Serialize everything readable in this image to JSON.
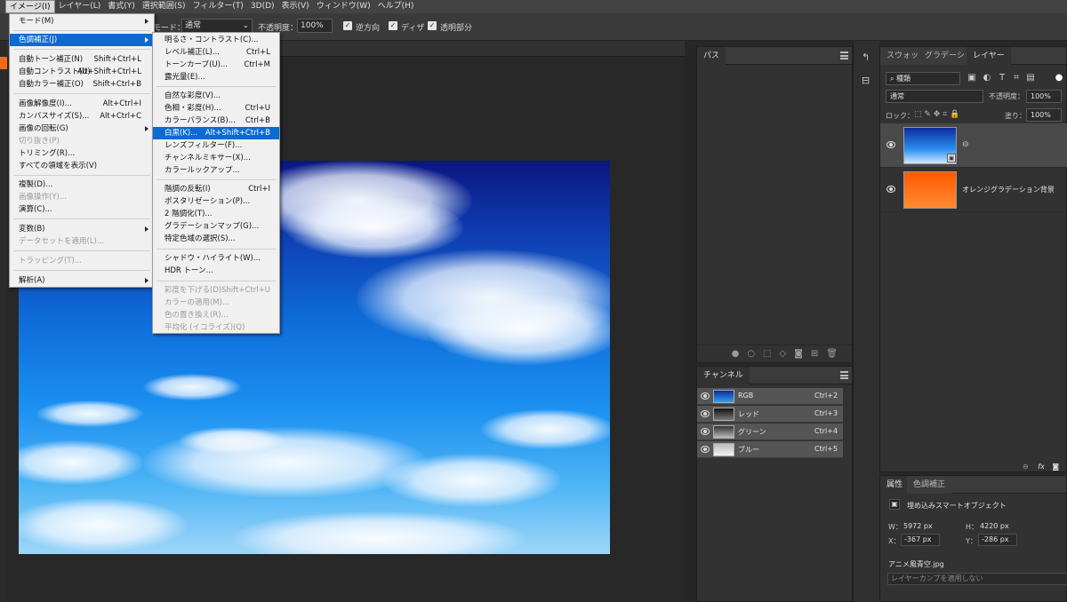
{
  "menubar": {
    "items": [
      "イメージ(I)",
      "レイヤー(L)",
      "書式(Y)",
      "選択範囲(S)",
      "フィルター(T)",
      "3D(D)",
      "表示(V)",
      "ウィンドウ(W)",
      "ヘルプ(H)"
    ]
  },
  "options": {
    "mode_label": "モード：",
    "mode_value": "通常",
    "opacity_label": "不透明度：",
    "opacity_value": "100%",
    "reverse": "逆方向",
    "dither": "ディザ",
    "transparency": "透明部分"
  },
  "image_menu": {
    "items": [
      {
        "label": "モード(M)",
        "shortcut": "",
        "submenu": true,
        "disabled": false
      },
      {
        "label": "色調補正(J)",
        "shortcut": "",
        "submenu": true,
        "disabled": false
      },
      {
        "label": "自動トーン補正(N)",
        "shortcut": "Shift+Ctrl+L",
        "submenu": false,
        "disabled": false
      },
      {
        "label": "自動コントラスト(U)",
        "shortcut": "Alt+Shift+Ctrl+L",
        "submenu": false,
        "disabled": false
      },
      {
        "label": "自動カラー補正(O)",
        "shortcut": "Shift+Ctrl+B",
        "submenu": false,
        "disabled": false
      },
      {
        "label": "画像解像度(I)...",
        "shortcut": "Alt+Ctrl+I",
        "submenu": false,
        "disabled": false
      },
      {
        "label": "カンバスサイズ(S)...",
        "shortcut": "Alt+Ctrl+C",
        "submenu": false,
        "disabled": false
      },
      {
        "label": "画像の回転(G)",
        "shortcut": "",
        "submenu": true,
        "disabled": false
      },
      {
        "label": "切り抜き(P)",
        "shortcut": "",
        "submenu": false,
        "disabled": true
      },
      {
        "label": "トリミング(R)...",
        "shortcut": "",
        "submenu": false,
        "disabled": false
      },
      {
        "label": "すべての領域を表示(V)",
        "shortcut": "",
        "submenu": false,
        "disabled": false
      },
      {
        "label": "複製(D)...",
        "shortcut": "",
        "submenu": false,
        "disabled": false
      },
      {
        "label": "画像操作(Y)...",
        "shortcut": "",
        "submenu": false,
        "disabled": true
      },
      {
        "label": "演算(C)...",
        "shortcut": "",
        "submenu": false,
        "disabled": false
      },
      {
        "label": "変数(B)",
        "shortcut": "",
        "submenu": true,
        "disabled": false
      },
      {
        "label": "データセットを適用(L)...",
        "shortcut": "",
        "submenu": false,
        "disabled": true
      },
      {
        "label": "トラッピング(T)...",
        "shortcut": "",
        "submenu": false,
        "disabled": true
      },
      {
        "label": "解析(A)",
        "shortcut": "",
        "submenu": true,
        "disabled": false
      }
    ]
  },
  "adjust_menu": {
    "items": [
      {
        "label": "明るさ・コントラスト(C)...",
        "shortcut": "",
        "disabled": false
      },
      {
        "label": "レベル補正(L)...",
        "shortcut": "Ctrl+L",
        "disabled": false
      },
      {
        "label": "トーンカーブ(U)...",
        "shortcut": "Ctrl+M",
        "disabled": false
      },
      {
        "label": "露光量(E)...",
        "shortcut": "",
        "disabled": false
      },
      {
        "label": "自然な彩度(V)...",
        "shortcut": "",
        "disabled": false
      },
      {
        "label": "色相・彩度(H)...",
        "shortcut": "Ctrl+U",
        "disabled": false
      },
      {
        "label": "カラーバランス(B)...",
        "shortcut": "Ctrl+B",
        "disabled": false
      },
      {
        "label": "白黒(K)...",
        "shortcut": "Alt+Shift+Ctrl+B",
        "disabled": false
      },
      {
        "label": "レンズフィルター(F)...",
        "shortcut": "",
        "disabled": false
      },
      {
        "label": "チャンネルミキサー(X)...",
        "shortcut": "",
        "disabled": false
      },
      {
        "label": "カラールックアップ...",
        "shortcut": "",
        "disabled": false
      },
      {
        "label": "階調の反転(I)",
        "shortcut": "Ctrl+I",
        "disabled": false
      },
      {
        "label": "ポスタリゼーション(P)...",
        "shortcut": "",
        "disabled": false
      },
      {
        "label": "2 階調化(T)...",
        "shortcut": "",
        "disabled": false
      },
      {
        "label": "グラデーションマップ(G)...",
        "shortcut": "",
        "disabled": false
      },
      {
        "label": "特定色域の選択(S)...",
        "shortcut": "",
        "disabled": false
      },
      {
        "label": "シャドウ・ハイライト(W)...",
        "shortcut": "",
        "disabled": false
      },
      {
        "label": "HDR トーン...",
        "shortcut": "",
        "disabled": false
      },
      {
        "label": "彩度を下げる(D)",
        "shortcut": "Shift+Ctrl+U",
        "disabled": true
      },
      {
        "label": "カラーの適用(M)...",
        "shortcut": "",
        "disabled": true
      },
      {
        "label": "色の置き換え(R)...",
        "shortcut": "",
        "disabled": true
      },
      {
        "label": "平均化 (イコライズ)(Q)",
        "shortcut": "",
        "disabled": true
      }
    ]
  },
  "paths_panel": {
    "title": "パス"
  },
  "channels_panel": {
    "title": "チャンネル",
    "rows": [
      {
        "name": "RGB",
        "shortcut": "Ctrl+2"
      },
      {
        "name": "レッド",
        "shortcut": "Ctrl+3"
      },
      {
        "name": "グリーン",
        "shortcut": "Ctrl+4"
      },
      {
        "name": "ブルー",
        "shortcut": "Ctrl+5"
      }
    ]
  },
  "layers_panel": {
    "tabs": [
      "スウォッチ",
      "グラデーション",
      "レイヤー"
    ],
    "kind_filter": "種類",
    "blend_mode": "通常",
    "opacity_label": "不透明度：",
    "opacity_value": "100%",
    "lock_label": "ロック：",
    "fill_label": "塗り：",
    "fill_value": "100%",
    "layers": [
      {
        "name": ""
      },
      {
        "name": "オレンジグラデーション背景"
      }
    ]
  },
  "properties_panel": {
    "tabs": [
      "属性",
      "色調補正"
    ],
    "object_type": "埋め込みスマートオブジェクト",
    "w_label": "W：",
    "w_value": "5972 px",
    "h_label": "H：",
    "h_value": "4220 px",
    "x_label": "X：",
    "x_value": "-367 px",
    "y_label": "Y：",
    "y_value": "-286 px",
    "filename": "アニメ風青空.jpg",
    "comp_placeholder": "レイヤーカンプを適用しない"
  },
  "colors": {
    "menu_highlight": "#0b6bd1",
    "tool_accent": "#f26b1a",
    "panel_bg": "#323232"
  }
}
